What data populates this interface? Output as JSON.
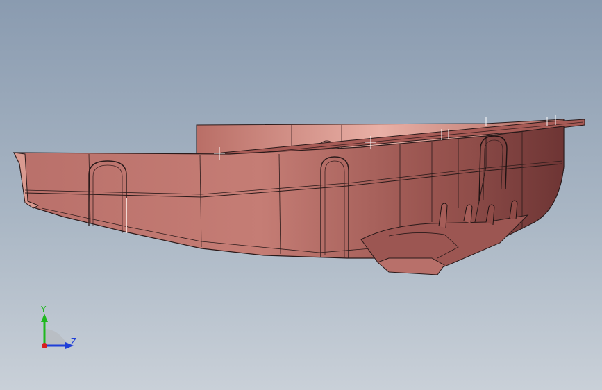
{
  "viewport": {
    "model": "part-3d-view",
    "background_colors": [
      "#8a9bb0",
      "#c9d0d8"
    ],
    "part_color": "#c07a72"
  },
  "triad": {
    "y_label": "Y",
    "z_label": "Z",
    "colors": {
      "y": "#1fb81f",
      "z": "#1f3fd8",
      "x": "#d81f1f"
    }
  }
}
